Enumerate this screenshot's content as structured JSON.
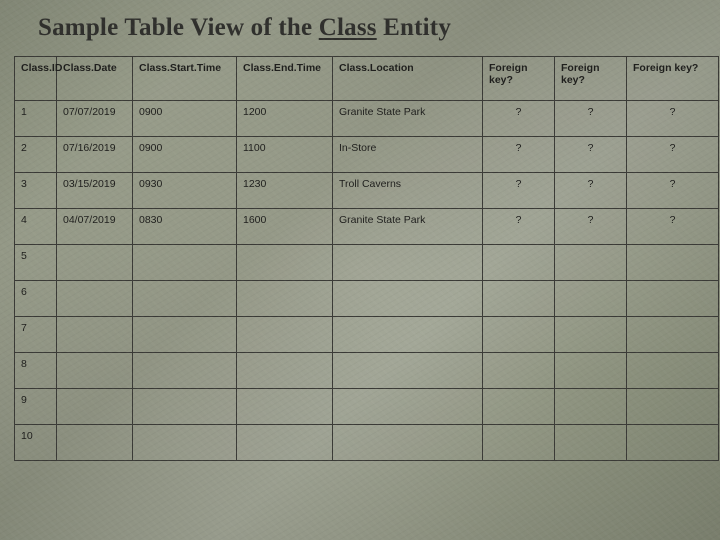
{
  "title": {
    "prefix": "Sample Table View of the ",
    "entity": "Class",
    "suffix": " Entity"
  },
  "chart_data": {
    "type": "table",
    "title": "Sample Table View of the Class Entity",
    "columns": [
      "Class.ID",
      "Class.Date",
      "Class.Start.Time",
      "Class.End.Time",
      "Class.Location",
      "Foreign key?",
      "Foreign key?",
      "Foreign key?"
    ],
    "rows": [
      {
        "id": "1",
        "date": "07/07/2019",
        "start": "0900",
        "end": "1200",
        "location": "Granite State Park",
        "fk1": "?",
        "fk2": "?",
        "fk3": "?"
      },
      {
        "id": "2",
        "date": "07/16/2019",
        "start": "0900",
        "end": "1100",
        "location": "In-Store",
        "fk1": "?",
        "fk2": "?",
        "fk3": "?"
      },
      {
        "id": "3",
        "date": "03/15/2019",
        "start": "0930",
        "end": "1230",
        "location": "Troll Caverns",
        "fk1": "?",
        "fk2": "?",
        "fk3": "?"
      },
      {
        "id": "4",
        "date": "04/07/2019",
        "start": "0830",
        "end": "1600",
        "location": "Granite State Park",
        "fk1": "?",
        "fk2": "?",
        "fk3": "?"
      },
      {
        "id": "5",
        "date": "",
        "start": "",
        "end": "",
        "location": "",
        "fk1": "",
        "fk2": "",
        "fk3": ""
      },
      {
        "id": "6",
        "date": "",
        "start": "",
        "end": "",
        "location": "",
        "fk1": "",
        "fk2": "",
        "fk3": ""
      },
      {
        "id": "7",
        "date": "",
        "start": "",
        "end": "",
        "location": "",
        "fk1": "",
        "fk2": "",
        "fk3": ""
      },
      {
        "id": "8",
        "date": "",
        "start": "",
        "end": "",
        "location": "",
        "fk1": "",
        "fk2": "",
        "fk3": ""
      },
      {
        "id": "9",
        "date": "",
        "start": "",
        "end": "",
        "location": "",
        "fk1": "",
        "fk2": "",
        "fk3": ""
      },
      {
        "id": "10",
        "date": "",
        "start": "",
        "end": "",
        "location": "",
        "fk1": "",
        "fk2": "",
        "fk3": ""
      }
    ]
  }
}
